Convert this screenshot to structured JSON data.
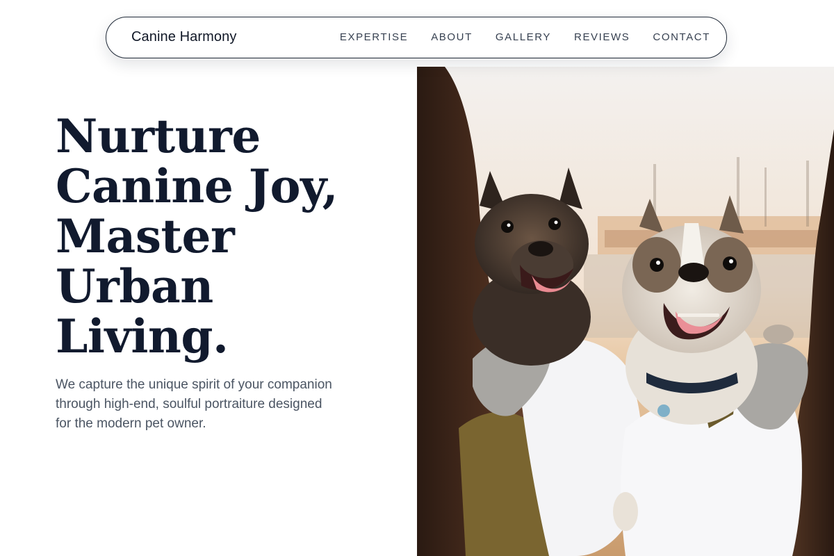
{
  "nav": {
    "brand": "Canine Harmony",
    "links": [
      "EXPERTISE",
      "ABOUT",
      "GALLERY",
      "REVIEWS",
      "CONTACT"
    ]
  },
  "hero": {
    "title_lines": [
      "Nurture",
      "Canine Joy,",
      "Master",
      "Urban",
      "Living."
    ],
    "subtitle": "We capture the unique spirit of your companion through high-end, soulful portraiture designed for the modern pet owner.",
    "image_alt": "Two French Bulldogs held by their owners outdoors at sunset"
  },
  "colors": {
    "heading": "#111a2e",
    "body_text": "#4b5563",
    "nav_text": "#374151",
    "nav_border": "#1f2937"
  }
}
